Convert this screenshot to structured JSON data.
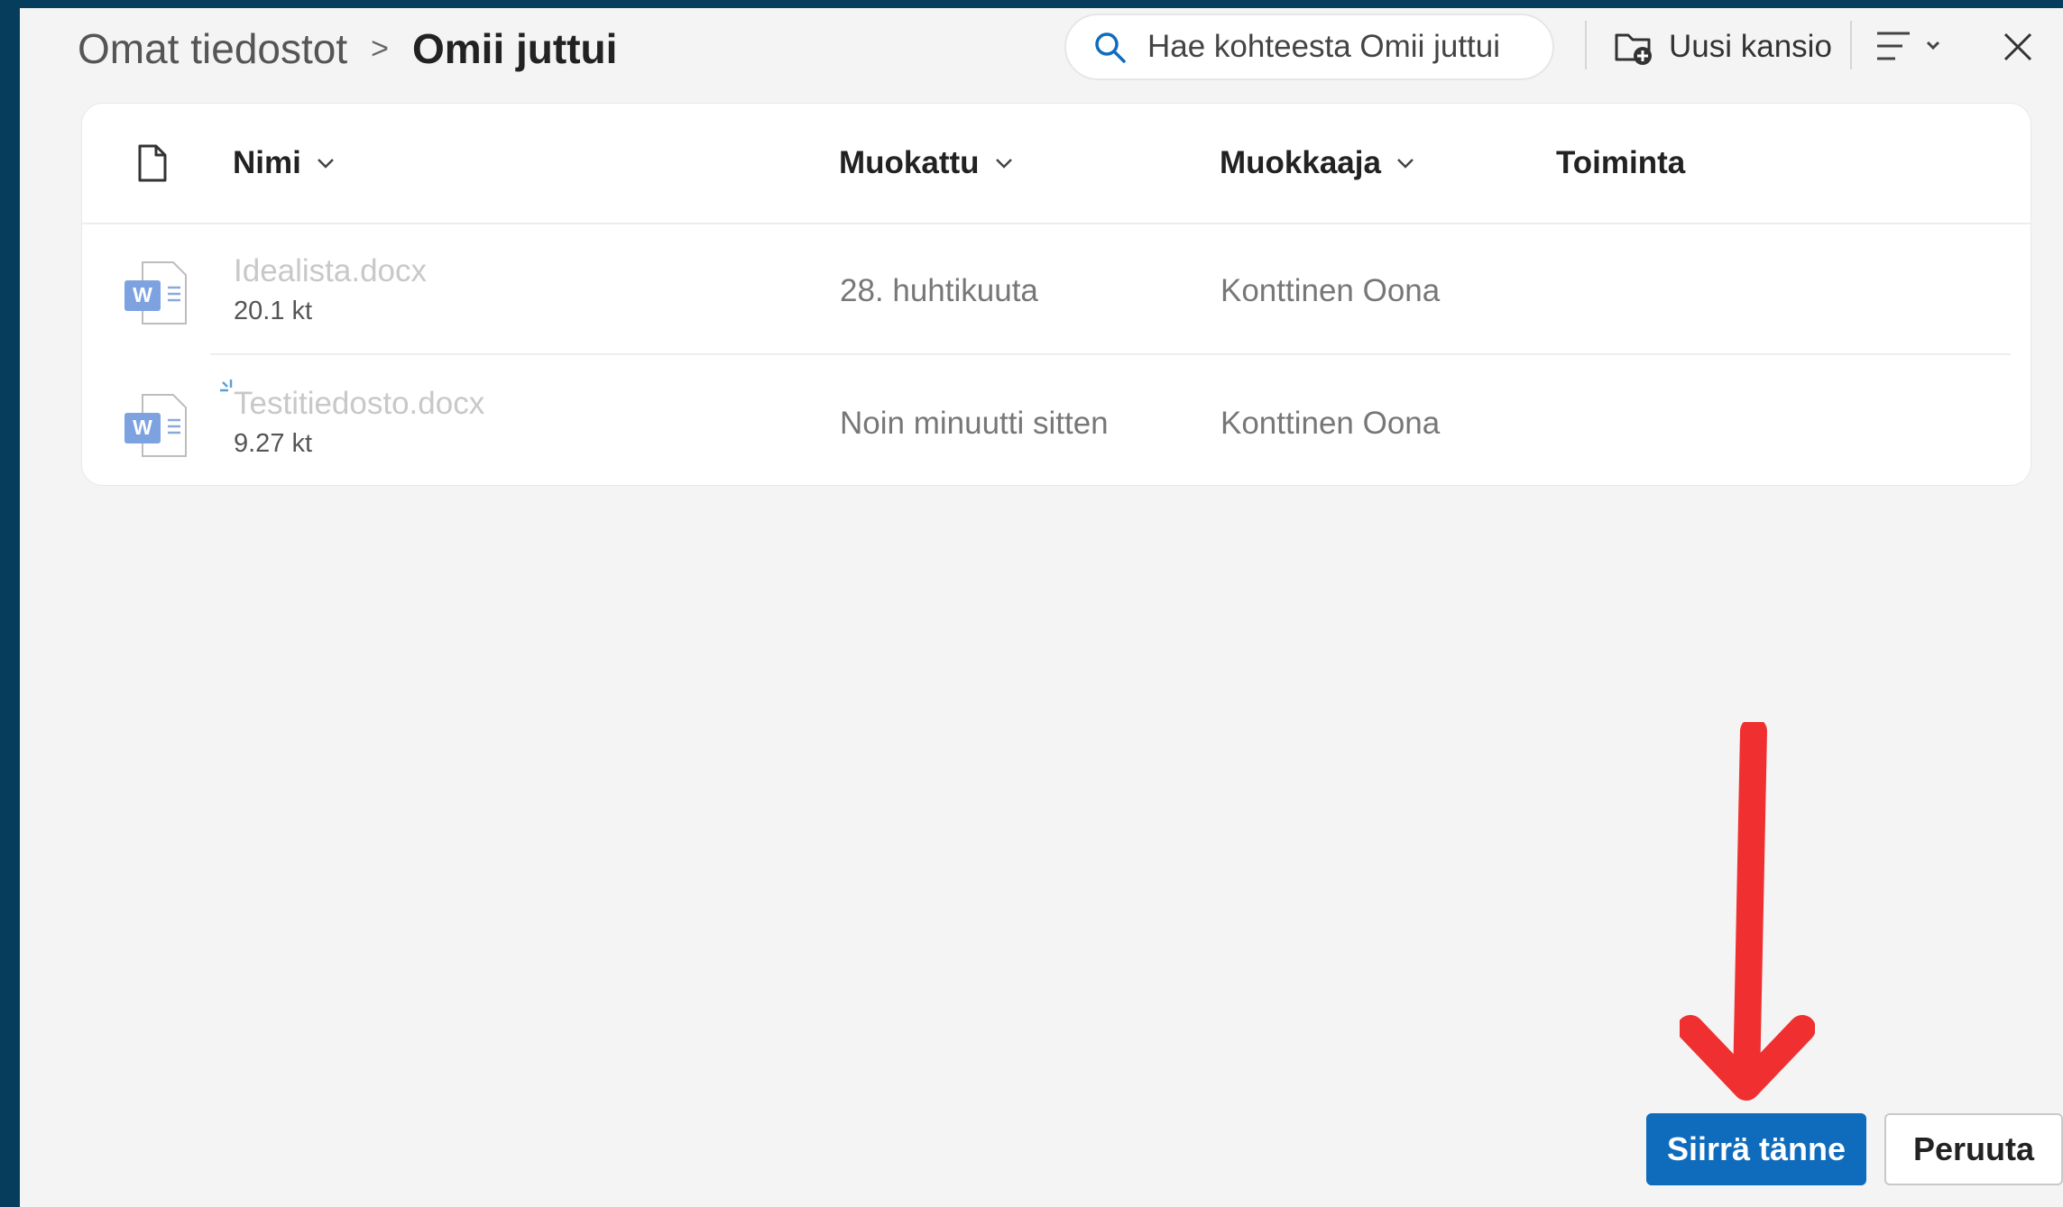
{
  "breadcrumb": {
    "root": "Omat tiedostot",
    "separator": ">",
    "current": "Omii juttui"
  },
  "search": {
    "placeholder": "Hae kohteesta Omii juttui",
    "icon": "search-icon"
  },
  "toolbar": {
    "new_folder_label": "Uusi kansio",
    "new_folder_icon": "folder-add-icon",
    "view_icon": "view-options-icon",
    "close_icon": "close-icon"
  },
  "table": {
    "columns": {
      "type_icon": "document-icon",
      "name": "Nimi",
      "modified": "Muokattu",
      "modified_by": "Muokkaaja",
      "activity": "Toiminta"
    },
    "rows": [
      {
        "name": "Idealista.docx",
        "size": "20.1 kt",
        "modified": "28. huhtikuuta",
        "modified_by": "Konttinen Oona",
        "icon": "word-file-icon",
        "syncing": false
      },
      {
        "name": "Testitiedosto.docx",
        "size": "9.27 kt",
        "modified": "Noin minuutti sitten",
        "modified_by": "Konttinen Oona",
        "icon": "word-file-icon",
        "syncing": true
      }
    ]
  },
  "actions": {
    "primary": "Siirrä tänne",
    "secondary": "Peruuta"
  },
  "annotation": {
    "type": "red-arrow",
    "points_to": "primary-button",
    "color": "#f03030"
  },
  "colors": {
    "primary": "#0f6cbd",
    "frame": "#063d5c",
    "panel": "#f4f4f4",
    "word": "#3f7fd6"
  }
}
